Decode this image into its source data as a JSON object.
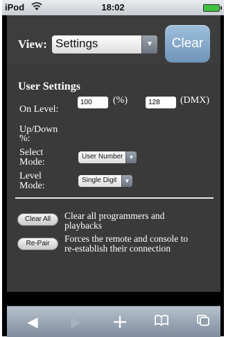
{
  "status_bar": {
    "carrier": "iPod",
    "wifi_icon": "wifi-icon",
    "time": "18:02",
    "battery_icon": "battery-icon"
  },
  "header": {
    "view_label": "View:",
    "view_select": {
      "selected": "Settings",
      "arrow": "▼"
    },
    "clear_button": "Clear"
  },
  "user_settings": {
    "heading": "User Settings",
    "on_level_label": "On Level:",
    "on_level_percent_value": "100",
    "on_level_percent_unit": "(%)",
    "on_level_dmx_value": "128",
    "on_level_dmx_unit": "(DMX)",
    "up_down_label_line1": "Up/Down",
    "up_down_label_line2": "%:",
    "select_mode_label_line1": "Select",
    "select_mode_label_line2": "Mode:",
    "select_mode_value": "User Number",
    "level_mode_label_line1": "Level",
    "level_mode_label_line2": "Mode:",
    "level_mode_value": "Single Digit",
    "select_arrow": "▼"
  },
  "actions": {
    "clear_all_button": "Clear All",
    "clear_all_desc_line1": "Clear all programmers and",
    "clear_all_desc_line2": "playbacks",
    "repair_button": "Re-Pair",
    "repair_desc_line1": "Forces the remote and console to",
    "repair_desc_line2": "re-establish their connection"
  },
  "toolbar": {
    "back_icon": "◀",
    "forward_icon": "▶",
    "add_icon": "+",
    "bookmarks_icon": "📖",
    "pages_icon": "⧉"
  },
  "colors": {
    "app_bg": "#3a3a3a",
    "clear_button": "#7fa3c6",
    "toolbar": "#9aa7b6",
    "battery": "#3fbf3f"
  }
}
